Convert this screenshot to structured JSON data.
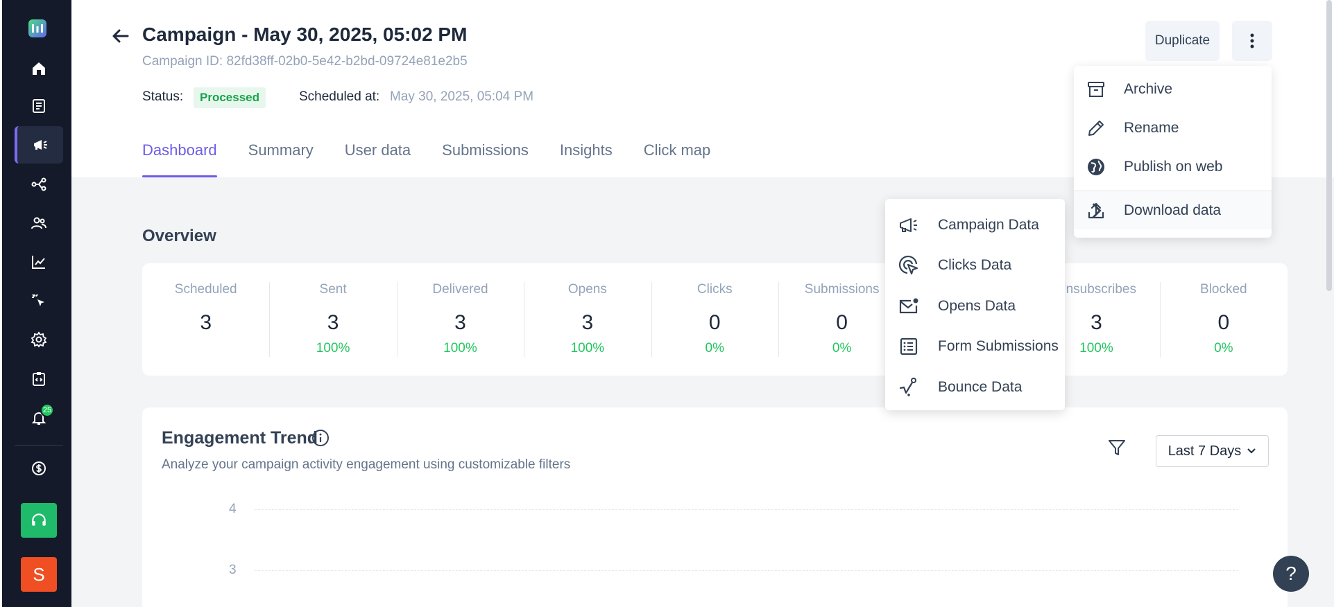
{
  "campaign": {
    "title": "Campaign - May 30, 2025, 05:02 PM",
    "id_text": "Campaign ID: 82fd38ff-02b0-5e42-b2bd-09724e81e2b5",
    "status_label": "Status:",
    "status_value": "Processed",
    "scheduled_label": "Scheduled at:",
    "scheduled_value": "May 30, 2025, 05:04 PM"
  },
  "tabs": [
    "Dashboard",
    "Summary",
    "User data",
    "Submissions",
    "Insights",
    "Click map"
  ],
  "actions": {
    "duplicate": "Duplicate"
  },
  "more_menu": {
    "items": [
      "Archive",
      "Rename",
      "Publish on web",
      "Download data"
    ]
  },
  "download_menu": {
    "items": [
      "Campaign Data",
      "Clicks Data",
      "Opens Data",
      "Form Submissions",
      "Bounce Data"
    ]
  },
  "overview": {
    "title": "Overview",
    "stats": [
      {
        "label": "Scheduled",
        "value": "3",
        "pct": ""
      },
      {
        "label": "Sent",
        "value": "3",
        "pct": "100%"
      },
      {
        "label": "Delivered",
        "value": "3",
        "pct": "100%"
      },
      {
        "label": "Opens",
        "value": "3",
        "pct": "100%"
      },
      {
        "label": "Clicks",
        "value": "0",
        "pct": "0%"
      },
      {
        "label": "Submissions",
        "value": "0",
        "pct": "0%"
      },
      {
        "label": "",
        "value": "",
        "pct": ""
      },
      {
        "label": "Unsubscribes",
        "value": "3",
        "pct": "100%"
      },
      {
        "label": "Blocked",
        "value": "0",
        "pct": "0%"
      }
    ]
  },
  "trend": {
    "title": "Engagement Trend",
    "subtitle": "Analyze your campaign activity engagement using customizable filters",
    "range": "Last 7 Days",
    "y_ticks": [
      "4",
      "3"
    ]
  },
  "sidebar": {
    "notification_count": "25",
    "user_initial": "S"
  },
  "help": "?"
}
